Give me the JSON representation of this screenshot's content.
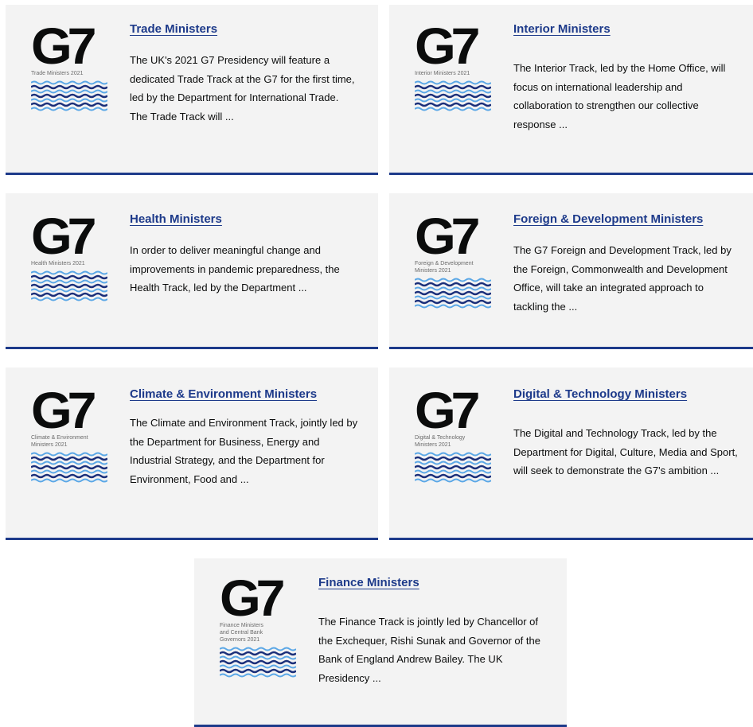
{
  "cards": [
    {
      "logo_text": "G7",
      "logo_sub": "Trade Ministers 2021",
      "title": "Trade Ministers",
      "desc": "The UK's 2021 G7 Presidency will feature a dedicated Trade Track at the G7 for the first time, led by the Department for International Trade. The Trade Track will ..."
    },
    {
      "logo_text": "G7",
      "logo_sub": "Interior Ministers 2021",
      "title": "Interior Ministers",
      "desc": "The Interior Track, led by the Home Office, will focus on international leadership and collaboration to strengthen our collective response ..."
    },
    {
      "logo_text": "G7",
      "logo_sub": "Health Ministers 2021",
      "title": "Health Ministers",
      "desc": "In order to deliver meaningful change and improvements in pandemic preparedness, the Health Track, led by the Department ..."
    },
    {
      "logo_text": "G7",
      "logo_sub": "Foreign & Development\nMinisters 2021",
      "title": "Foreign & Development Ministers",
      "desc": "The G7 Foreign and Development Track, led by the Foreign, Commonwealth and Development Office, will take an integrated approach to tackling the ..."
    },
    {
      "logo_text": "G7",
      "logo_sub": "Climate & Environment\nMinisters 2021",
      "title": "Climate & Environment Ministers",
      "desc": "The Climate and Environment Track, jointly led by the Department for Business, Energy and Industrial Strategy, and the Department for Environment, Food and ..."
    },
    {
      "logo_text": "G7",
      "logo_sub": "Digital & Technology\nMinisters 2021",
      "title": "Digital & Technology Ministers",
      "desc": "The Digital and Technology Track, led by the Department for Digital, Culture, Media and Sport, will seek to demonstrate the G7's ambition ..."
    },
    {
      "logo_text": "G7",
      "logo_sub": "Finance Ministers\nand Central Bank\nGovernors 2021",
      "title": "Finance Ministers",
      "desc": "The Finance Track is jointly led by Chancellor of the Exchequer, Rishi Sunak and Governor of the Bank of England Andrew Bailey. The UK Presidency ..."
    }
  ],
  "colors": {
    "card_bg": "#f3f3f3",
    "accent_border": "#1d3a8a",
    "title": "#1d3a8a",
    "wave_dark": "#1a2f7a",
    "wave_light": "#5aa7e6"
  }
}
